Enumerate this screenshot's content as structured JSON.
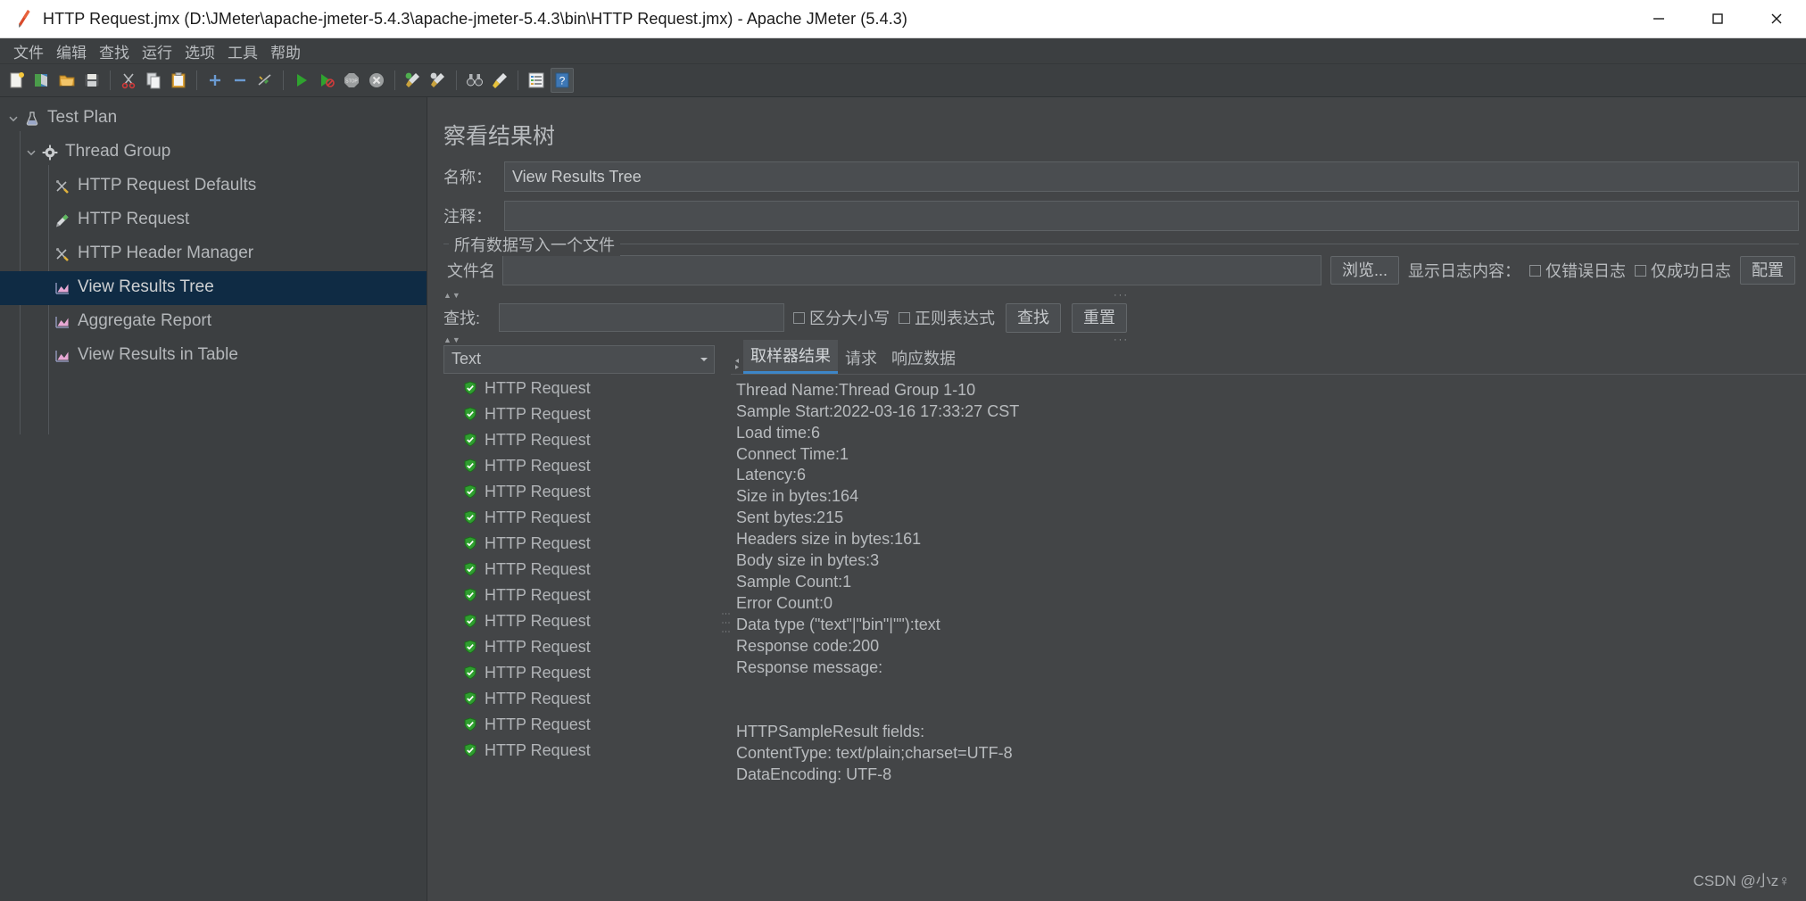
{
  "window": {
    "title": "HTTP Request.jmx (D:\\JMeter\\apache-jmeter-5.4.3\\apache-jmeter-5.4.3\\bin\\HTTP Request.jmx) - Apache JMeter (5.4.3)",
    "app_icon": "jmeter-feather-icon",
    "minimize_label": "—",
    "maximize_label": "☐",
    "close_label": "✕"
  },
  "menubar": {
    "items": [
      {
        "label": "文件",
        "name": "menu-file"
      },
      {
        "label": "编辑",
        "name": "menu-edit"
      },
      {
        "label": "查找",
        "name": "menu-search"
      },
      {
        "label": "运行",
        "name": "menu-run"
      },
      {
        "label": "选项",
        "name": "menu-options"
      },
      {
        "label": "工具",
        "name": "menu-tools"
      },
      {
        "label": "帮助",
        "name": "menu-help"
      }
    ]
  },
  "toolbar": {
    "buttons": [
      {
        "icon": "new-document-icon"
      },
      {
        "icon": "open-templates-icon"
      },
      {
        "icon": "open-folder-icon"
      },
      {
        "icon": "save-icon"
      },
      {
        "sep": true
      },
      {
        "icon": "cut-scissors-icon"
      },
      {
        "icon": "copy-icon"
      },
      {
        "icon": "paste-clipboard-icon"
      },
      {
        "sep": true
      },
      {
        "icon": "expand-plus-icon"
      },
      {
        "icon": "collapse-minus-icon"
      },
      {
        "icon": "toggle-enable-icon"
      },
      {
        "sep": true
      },
      {
        "icon": "start-play-icon"
      },
      {
        "icon": "start-no-timers-icon"
      },
      {
        "icon": "stop-icon"
      },
      {
        "icon": "shutdown-icon"
      },
      {
        "sep": true
      },
      {
        "icon": "clear-broom-icon"
      },
      {
        "icon": "clear-all-broom-icon"
      },
      {
        "sep": true
      },
      {
        "icon": "search-binoculars-icon"
      },
      {
        "icon": "reset-search-broom-icon"
      },
      {
        "sep": true
      },
      {
        "icon": "function-helper-icon"
      },
      {
        "icon": "help-question-icon"
      }
    ]
  },
  "tree": {
    "items": [
      {
        "label": "Test Plan",
        "icon": "test-plan-icon",
        "indent": 0,
        "twisty": "expanded",
        "selected": false,
        "name": "tree-item-test-plan"
      },
      {
        "label": "Thread Group",
        "icon": "thread-group-gear-icon",
        "indent": 1,
        "twisty": "expanded",
        "selected": false,
        "name": "tree-item-thread-group"
      },
      {
        "label": "HTTP Request Defaults",
        "icon": "config-element-icon",
        "indent": 2,
        "twisty": "none",
        "selected": false,
        "name": "tree-item-http-request-defaults"
      },
      {
        "label": "HTTP Request",
        "icon": "sampler-icon",
        "indent": 2,
        "twisty": "none",
        "selected": false,
        "name": "tree-item-http-request"
      },
      {
        "label": "HTTP Header Manager",
        "icon": "config-element-icon",
        "indent": 2,
        "twisty": "none",
        "selected": false,
        "name": "tree-item-http-header-manager"
      },
      {
        "label": "View Results Tree",
        "icon": "listener-icon",
        "indent": 2,
        "twisty": "none",
        "selected": true,
        "name": "tree-item-view-results-tree"
      },
      {
        "label": "Aggregate Report",
        "icon": "listener-icon",
        "indent": 2,
        "twisty": "none",
        "selected": false,
        "name": "tree-item-aggregate-report"
      },
      {
        "label": "View Results in Table",
        "icon": "listener-icon",
        "indent": 2,
        "twisty": "none",
        "selected": false,
        "name": "tree-item-view-results-in-table"
      }
    ]
  },
  "panel": {
    "title": "察看结果树",
    "name_label": "名称：",
    "name_value": "View Results Tree",
    "comment_label": "注释：",
    "comment_value": "",
    "group_title": "所有数据写入一个文件",
    "filename_label": "文件名",
    "filename_value": "",
    "browse_button": "浏览...",
    "log_display_label": "显示日志内容：",
    "errors_only_label": "仅错误日志",
    "errors_only_checked": false,
    "success_only_label": "仅成功日志",
    "success_only_checked": false,
    "configure_button": "配置",
    "search_label": "查找:",
    "search_value": "",
    "case_sensitive_label": "区分大小写",
    "case_sensitive_checked": false,
    "regexp_label": "正则表达式",
    "regexp_checked": false,
    "search_button": "查找",
    "reset_button": "重置",
    "renderer_value": "Text",
    "split_arrows": "▲▼",
    "split_dots": "···"
  },
  "results": {
    "items": [
      {
        "label": "HTTP Request",
        "status": "success"
      },
      {
        "label": "HTTP Request",
        "status": "success"
      },
      {
        "label": "HTTP Request",
        "status": "success"
      },
      {
        "label": "HTTP Request",
        "status": "success"
      },
      {
        "label": "HTTP Request",
        "status": "success"
      },
      {
        "label": "HTTP Request",
        "status": "success"
      },
      {
        "label": "HTTP Request",
        "status": "success"
      },
      {
        "label": "HTTP Request",
        "status": "success"
      },
      {
        "label": "HTTP Request",
        "status": "success"
      },
      {
        "label": "HTTP Request",
        "status": "success"
      },
      {
        "label": "HTTP Request",
        "status": "success"
      },
      {
        "label": "HTTP Request",
        "status": "success"
      },
      {
        "label": "HTTP Request",
        "status": "success"
      },
      {
        "label": "HTTP Request",
        "status": "success"
      },
      {
        "label": "HTTP Request",
        "status": "success"
      }
    ]
  },
  "tabs": [
    {
      "label": "取样器结果",
      "active": true,
      "name": "tab-sampler-result"
    },
    {
      "label": "请求",
      "active": false,
      "name": "tab-request"
    },
    {
      "label": "响应数据",
      "active": false,
      "name": "tab-response-data"
    }
  ],
  "sampler_result": {
    "text": "Thread Name:Thread Group 1-10\nSample Start:2022-03-16 17:33:27 CST\nLoad time:6\nConnect Time:1\nLatency:6\nSize in bytes:164\nSent bytes:215\nHeaders size in bytes:161\nBody size in bytes:3\nSample Count:1\nError Count:0\nData type (\"text\"|\"bin\"|\"\"):text\nResponse code:200\nResponse message:\n\n\nHTTPSampleResult fields:\nContentType: text/plain;charset=UTF-8\nDataEncoding: UTF-8"
  },
  "watermark": "CSDN @小z♀",
  "colors": {
    "window_bg": "#434547",
    "panel_bg": "#3c3f41",
    "selection": "#0f2b44",
    "accent": "#3d86c8",
    "text": "#b7babd",
    "success_green": "#3ba53b"
  }
}
